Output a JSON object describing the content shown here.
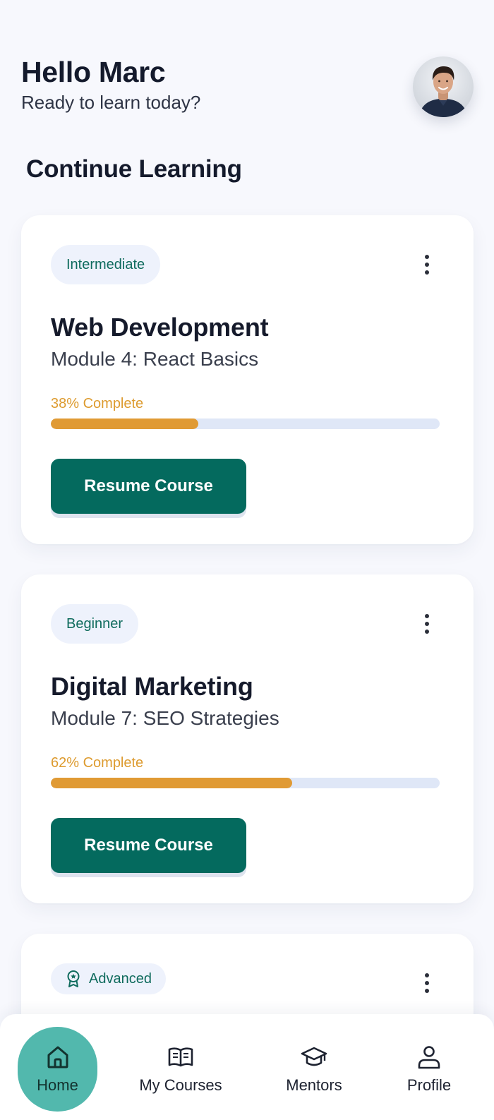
{
  "header": {
    "greeting": "Hello Marc",
    "subtitle": "Ready to learn today?"
  },
  "section": {
    "title": "Continue Learning"
  },
  "courses": [
    {
      "level": "Intermediate",
      "title": "Web Development",
      "module": "Module 4: React Basics",
      "progress_label": "38% Complete",
      "progress": 0.38,
      "button": "Resume Course"
    },
    {
      "level": "Beginner",
      "title": "Digital Marketing",
      "module": "Module 7: SEO Strategies",
      "progress_label": "62% Complete",
      "progress": 0.62,
      "button": "Resume Course"
    },
    {
      "level": "Advanced",
      "level_icon": "award-ribbon-icon"
    }
  ],
  "nav": {
    "items": [
      {
        "label": "Home",
        "icon": "home-icon",
        "active": true
      },
      {
        "label": "My Courses",
        "icon": "book-open-icon",
        "active": false
      },
      {
        "label": "Mentors",
        "icon": "graduation-cap-icon",
        "active": false
      },
      {
        "label": "Profile",
        "icon": "user-icon",
        "active": false
      }
    ]
  },
  "colors": {
    "accent": "#046a5e",
    "progress": "#e09a34",
    "active_nav": "#52b8ad"
  }
}
